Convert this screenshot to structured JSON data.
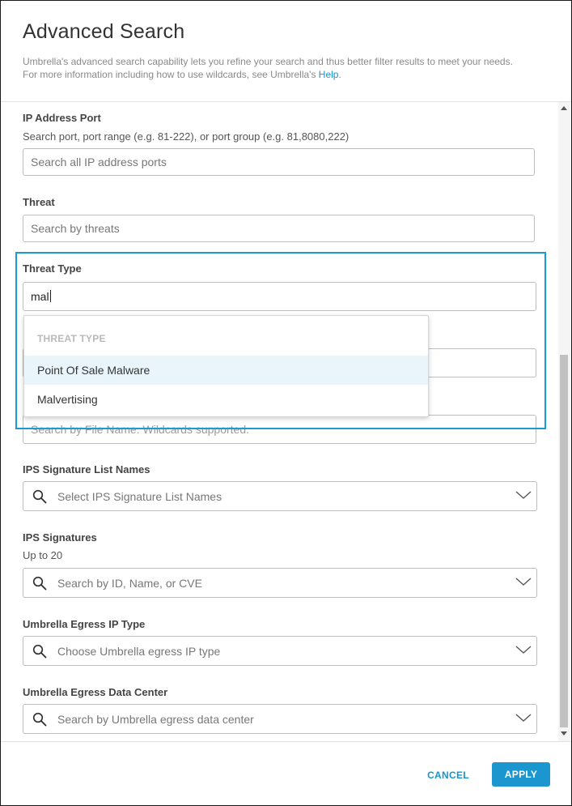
{
  "header": {
    "title": "Advanced Search",
    "description_line1": "Umbrella's advanced search capability lets you refine your search and thus better filter results to meet your needs.",
    "description_line2_prefix": "For more information including how to use wildcards, see Umbrella's ",
    "help_link": "Help",
    "description_line2_suffix": "."
  },
  "fields": {
    "ip_port": {
      "label": "IP Address Port",
      "hint": "Search port, port range (e.g. 81-222), or port group (e.g. 81,8080,222)",
      "placeholder": "Search all IP address ports"
    },
    "threat": {
      "label": "Threat",
      "placeholder": "Search by threats"
    },
    "threat_type": {
      "label": "Threat Type",
      "value": "mal"
    },
    "file_name": {
      "placeholder": "Search by File Name. Wildcards supported."
    },
    "ips_list": {
      "label": "IPS Signature List Names",
      "placeholder": "Select IPS Signature List Names"
    },
    "ips_signatures": {
      "label": "IPS Signatures",
      "hint": "Up to 20",
      "placeholder": "Search by ID, Name, or CVE"
    },
    "egress_ip_type": {
      "label": "Umbrella Egress IP Type",
      "placeholder": "Choose Umbrella egress IP type"
    },
    "egress_dc": {
      "label": "Umbrella Egress Data Center",
      "placeholder": "Search by Umbrella egress data center"
    }
  },
  "dropdown": {
    "header": "THREAT TYPE",
    "options": [
      "Point Of Sale Malware",
      "Malvertising"
    ]
  },
  "footer": {
    "cancel": "CANCEL",
    "apply": "APPLY"
  },
  "colors": {
    "accent": "#1a95c8",
    "highlight_border": "#1a9bd3",
    "option_hover": "#e9f5fb"
  }
}
